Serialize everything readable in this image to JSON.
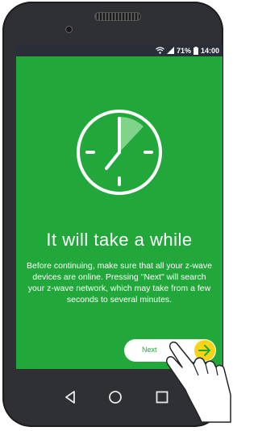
{
  "status_bar": {
    "battery_percent": "71%",
    "time": "14:00",
    "icons": [
      "wifi-icon",
      "signal-icon",
      "battery-icon"
    ]
  },
  "main": {
    "icon": "clock-icon",
    "title": "It will take a while",
    "description": "Before continuing, make sure that all your z-wave devices are online. Pressing \"Next\" will search your z-wave network, which may take from a few seconds to several minutes."
  },
  "next_button": {
    "label": "Next",
    "icon": "arrow-right-icon"
  },
  "nav_bar": {
    "buttons": [
      "back-icon",
      "home-icon",
      "recents-icon"
    ]
  },
  "colors": {
    "screen_background": "#22a83a",
    "status_bar": "#2a2e38",
    "arrow_accent": "#f7d417",
    "phone_body": "#2f3033"
  }
}
